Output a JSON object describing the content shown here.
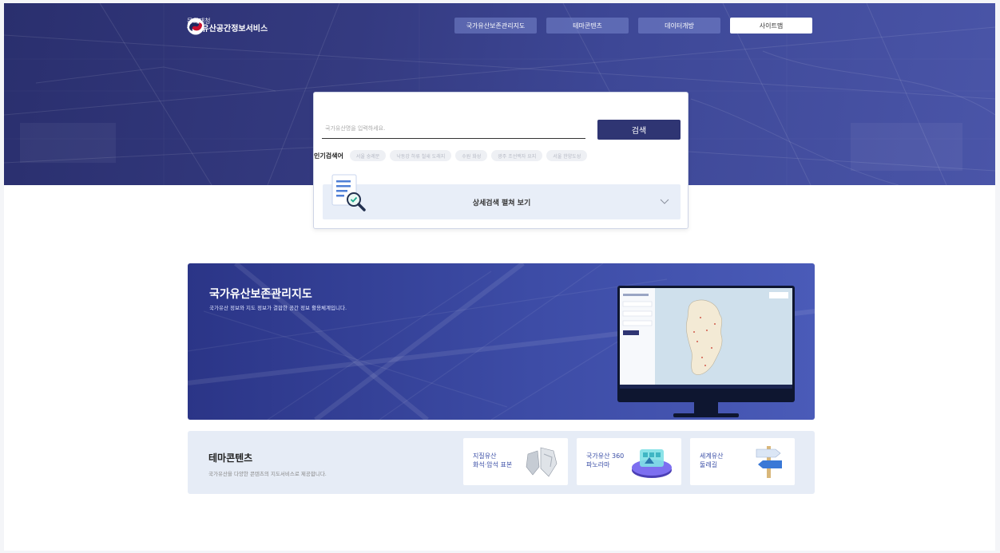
{
  "header": {
    "logo_sub": "문화재청",
    "logo_main": "국가유산공간정보서비스",
    "nav": [
      {
        "label": "국가유산보존관리지도",
        "active": false
      },
      {
        "label": "테마콘텐츠",
        "active": false
      },
      {
        "label": "데이터개방",
        "active": false
      },
      {
        "label": "사이트맵",
        "active": true
      }
    ]
  },
  "search": {
    "placeholder": "국가유산명을 입력하세요.",
    "button_label": "검색",
    "popular_label": "인기검색어",
    "popular_tags": [
      "서울 숭례문",
      "낙동강 하류 철새 도래지",
      "수원 화성",
      "광주 조선백자 요지",
      "서울 한양도성"
    ],
    "detail_label": "상세검색 펼쳐 보기"
  },
  "banner": {
    "title": "국가유산보존관리지도",
    "description": "국가유산 정보와 지도 정보가 결합한 공간 정보 활용체계입니다."
  },
  "theme": {
    "title": "테마콘텐츠",
    "description": "국가유산을 다양한 콘텐츠의 지도서비스로 제공합니다.",
    "cards": [
      {
        "line1": "지질유산",
        "line2": "화석·암석 표본",
        "icon": "rock-icon"
      },
      {
        "line1": "국가유산 360",
        "line2": "파노라마",
        "icon": "panorama-360-icon"
      },
      {
        "line1": "세계유산",
        "line2": "둘레길",
        "icon": "signpost-icon"
      }
    ]
  },
  "colors": {
    "hero": "#343a80",
    "search_button": "#2f3573",
    "banner": "#3d4ca6",
    "theme_bg": "#e6ecf6",
    "accent_text": "#3a4ea6"
  }
}
